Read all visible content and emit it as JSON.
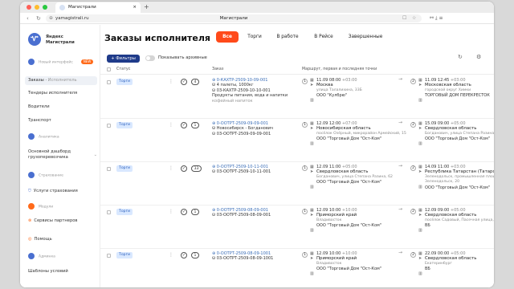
{
  "browser": {
    "tab_title": "Магистрали",
    "url": "yamagistrali.ru",
    "page_title": "Магистрали"
  },
  "sidebar": {
    "brand_line1": "Яндекс",
    "brand_line2": "Магистрали",
    "logo_letter": "Ꮙ",
    "sections": [
      {
        "label": "Новый интерфейс",
        "badge": "NEW",
        "color": "#4a6fd0"
      },
      {
        "label": "Аналитика",
        "color": "#4a6fd0"
      },
      {
        "label": "Страхование",
        "color": "#4a6fd0"
      },
      {
        "label": "Модули",
        "color": "#ff6a1a"
      },
      {
        "label": "Админка",
        "color": "#4a6fd0"
      }
    ],
    "items": [
      {
        "label": "Заказы",
        "sub": "Исполнитель"
      },
      {
        "label": "Тендеры исполнителя"
      },
      {
        "label": "Водители"
      },
      {
        "label": "Транспорт"
      },
      {
        "label": "Основной дашборд грузоперевозчика"
      },
      {
        "label": "Услуги страхования"
      },
      {
        "label": "Сервисы партнеров"
      },
      {
        "label": "Помощь"
      },
      {
        "label": "Шаблоны условий"
      }
    ]
  },
  "main": {
    "title": "Заказы исполнителя",
    "tabs": [
      "Все",
      "Торги",
      "В работе",
      "В Рейсе",
      "Завершенные"
    ],
    "filters_label": "Фильтры",
    "archive_label": "Показывать архивные",
    "columns": {
      "status": "Статус",
      "order": "Заказ",
      "route": "Маршрут, первая и последняя точки"
    }
  },
  "orders": [
    {
      "status": "Торги",
      "count": "4",
      "id": "0-КАХТР-2509-10-09-001",
      "cargo": "4 палеты, 1000кг",
      "sub_id": "03-КАХТР-2509-10-10-001",
      "desc1": "Продукты питания, вода и напитки",
      "desc2": "кофейный напиток",
      "p1": {
        "n": "1",
        "time": "11.09 08:00",
        "tz": "+03:00",
        "city": "Москва",
        "addr": "улица Талалихина, 33Б",
        "org": "ООО \"Кулбрю\""
      },
      "p2": {
        "n": "2",
        "time": "11.09 12:45",
        "tz": "+03:00",
        "city": "Московская область",
        "addr": "городской округ Химки",
        "org": "ТОРГОВЫЙ ДОМ ПЕРЕКРЕСТОК"
      }
    },
    {
      "status": "Торги",
      "count": "1",
      "id": "0-ООТРТ-2509-09-09-001",
      "cargo": "Новосибирск - Богданович",
      "sub_id": "03-ООТРТ-2509-09-09-001",
      "p1": {
        "n": "1",
        "time": "12.09 12:00",
        "tz": "+07:00",
        "city": "Новосибирская область",
        "addr": "посёлок Озёрный, микрорайон Армейский, 15",
        "org": "ООО \"Торговый Дом \"Ост-Ком\""
      },
      "p2": {
        "n": "2",
        "time": "15.09 09:00",
        "tz": "+05:00",
        "city": "Свердловская область",
        "addr": "Богданович, улица Степана Разина, 62",
        "org": "ООО \"Торговый Дом \"Ост-Ком\""
      }
    },
    {
      "status": "Торги",
      "count": "33",
      "id": "0-ООТРТ-2509-10-11-001",
      "sub_id": "03-ООТРТ-2509-10-11-001",
      "p1": {
        "n": "1",
        "time": "12.09 11:00",
        "tz": "+05:00",
        "city": "Свердловская область",
        "addr": "Богданович, улица Степана Разина, 62",
        "org": "ООО \"Торговый Дом \"Ост-Ком\""
      },
      "p2": {
        "n": "2",
        "time": "14.09 11:00",
        "tz": "+03:00",
        "city": "Республика Татарстан (Татарстан)",
        "addr": "Зеленодольск, промышленная площадка Зеленодольск, 20",
        "org": "ООО \"Торговый Дом \"Ост-Ком\""
      }
    },
    {
      "status": "Торги",
      "count": "1",
      "id": "0-ООТРТ-2509-08-09-001",
      "sub_id": "03-ООТРТ-2509-08-09-001",
      "p1": {
        "n": "1",
        "time": "12.09 10:00",
        "tz": "+10:00",
        "city": "Приморский край",
        "addr": "Владивосток",
        "org": "ООО \"Торговый Дом \"Ост-Ком\""
      },
      "p2": {
        "n": "2",
        "time": "12.09 09:00",
        "tz": "+05:00",
        "city": "Свердловская область",
        "addr": "посёлок Садовый, Пасечная улица, 11/1к2",
        "org": "ВБ"
      }
    },
    {
      "status": "Торги",
      "count": "1",
      "id": "0-ООТРТ-2509-08-09-1001",
      "sub_id": "03-ООТРТ-2509-08-09-1001",
      "p1": {
        "n": "1",
        "time": "12.09 10:00",
        "tz": "+10:00",
        "city": "Приморский край",
        "addr": "Владивосток",
        "org": "ООО \"Торговый Дом \"Ост-Ком\""
      },
      "p2": {
        "n": "2",
        "time": "22.09 00:00",
        "tz": "+05:00",
        "city": "Свердловская область",
        "addr": "Екатеринбург",
        "org": "ВБ"
      }
    }
  ]
}
